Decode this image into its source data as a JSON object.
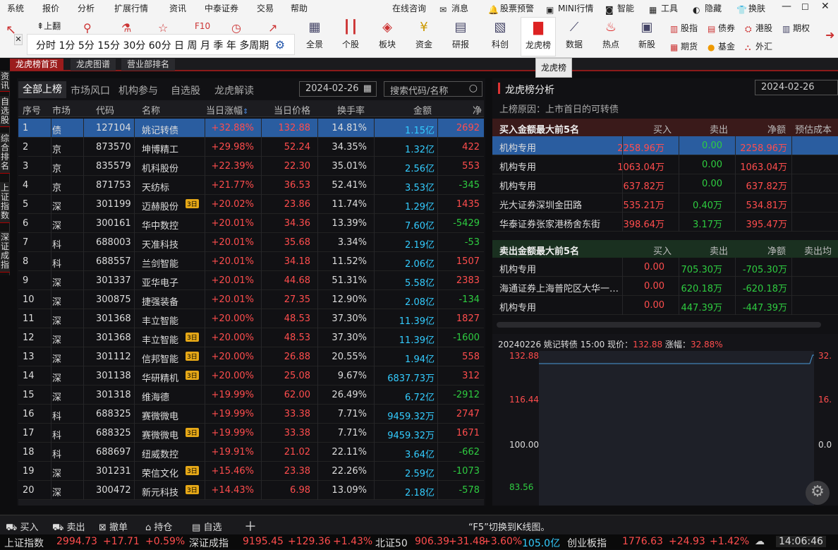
{
  "menu": {
    "items": [
      "系统",
      "报价",
      "分析",
      "扩展行情",
      "资讯",
      "中泰证券",
      "交易",
      "帮助"
    ],
    "right": [
      "在线咨询",
      "消息",
      "股票预警",
      "MINI行情",
      "智能",
      "工具",
      "隐藏",
      "换肤"
    ]
  },
  "toolbar": {
    "left_label": "上翻",
    "buttons": [
      "全景",
      "个股",
      "板块",
      "资金",
      "研报",
      "科创",
      "龙虎榜",
      "数据",
      "热点",
      "新股"
    ],
    "right": [
      [
        "股指",
        "债券",
        "港股",
        "期权"
      ],
      [
        "期货",
        "基金",
        "外汇"
      ]
    ]
  },
  "periods": [
    "分时",
    "1分",
    "5分",
    "15分",
    "30分",
    "60分",
    "日",
    "周",
    "月",
    "季",
    "年",
    "多周期"
  ],
  "tooltip": "龙虎榜",
  "tabs": [
    "龙虎榜首页",
    "龙虎图谱",
    "营业部排名"
  ],
  "sidebar": [
    "资讯",
    "自选股",
    "综合排名",
    "上证指数",
    "深证成指"
  ],
  "left": {
    "subtabs": [
      "全部上榜",
      "市场风口",
      "机构参与",
      "自选股",
      "龙虎解读"
    ],
    "date": "2024-02-26",
    "search_placeholder": "搜索代码/名称",
    "headers": [
      "序号",
      "市场",
      "代码",
      "名称",
      "当日涨幅",
      "当日价格",
      "换手率",
      "金额",
      "净"
    ],
    "rows": [
      [
        "1",
        "债",
        "127104",
        "姚记转债",
        "+32.88%",
        "132.88",
        "14.81%",
        "1.15亿",
        "2692",
        ""
      ],
      [
        "2",
        "京",
        "873570",
        "坤博精工",
        "+29.98%",
        "52.24",
        "34.35%",
        "1.32亿",
        "422",
        ""
      ],
      [
        "3",
        "京",
        "835579",
        "机科股份",
        "+22.39%",
        "22.30",
        "35.01%",
        "2.56亿",
        "553",
        ""
      ],
      [
        "4",
        "京",
        "871753",
        "天纺标",
        "+21.77%",
        "36.53",
        "52.41%",
        "3.53亿",
        "-345",
        ""
      ],
      [
        "5",
        "深",
        "301199",
        "迈赫股份",
        "+20.02%",
        "23.86",
        "11.74%",
        "1.29亿",
        "1435",
        "3日"
      ],
      [
        "6",
        "深",
        "300161",
        "华中数控",
        "+20.01%",
        "34.36",
        "13.39%",
        "7.60亿",
        "-5429",
        ""
      ],
      [
        "7",
        "科",
        "688003",
        "天准科技",
        "+20.01%",
        "35.68",
        "3.34%",
        "2.19亿",
        "-53",
        ""
      ],
      [
        "8",
        "科",
        "688557",
        "兰剑智能",
        "+20.01%",
        "34.18",
        "11.52%",
        "2.06亿",
        "1507",
        ""
      ],
      [
        "9",
        "深",
        "301337",
        "亚华电子",
        "+20.01%",
        "44.68",
        "51.31%",
        "5.58亿",
        "2383",
        ""
      ],
      [
        "10",
        "深",
        "300875",
        "捷强装备",
        "+20.01%",
        "27.35",
        "12.90%",
        "2.08亿",
        "-134",
        ""
      ],
      [
        "11",
        "深",
        "301368",
        "丰立智能",
        "+20.00%",
        "48.53",
        "37.30%",
        "11.39亿",
        "1827",
        ""
      ],
      [
        "12",
        "深",
        "301368",
        "丰立智能",
        "+20.00%",
        "48.53",
        "37.30%",
        "11.39亿",
        "-1600",
        "3日"
      ],
      [
        "13",
        "深",
        "301112",
        "信邦智能",
        "+20.00%",
        "26.88",
        "20.55%",
        "1.94亿",
        "558",
        "3日"
      ],
      [
        "14",
        "深",
        "301138",
        "华研精机",
        "+20.00%",
        "25.08",
        "9.67%",
        "6837.73万",
        "312",
        "3日"
      ],
      [
        "15",
        "深",
        "301318",
        "维海德",
        "+19.99%",
        "62.00",
        "26.49%",
        "6.72亿",
        "-2912",
        ""
      ],
      [
        "16",
        "科",
        "688325",
        "赛微微电",
        "+19.99%",
        "33.38",
        "7.71%",
        "9459.32万",
        "2747",
        ""
      ],
      [
        "17",
        "科",
        "688325",
        "赛微微电",
        "+19.99%",
        "33.38",
        "7.71%",
        "9459.32万",
        "1671",
        "3日"
      ],
      [
        "18",
        "科",
        "688697",
        "纽威数控",
        "+19.91%",
        "21.02",
        "22.11%",
        "3.64亿",
        "-662",
        ""
      ],
      [
        "19",
        "深",
        "301231",
        "荣信文化",
        "+15.46%",
        "23.38",
        "22.26%",
        "2.59亿",
        "-1073",
        "3日"
      ],
      [
        "20",
        "深",
        "300472",
        "新元科技",
        "+14.43%",
        "6.98",
        "13.09%",
        "2.18亿",
        "-578",
        "3日"
      ]
    ]
  },
  "right": {
    "title": "龙虎榜分析",
    "date": "2024-02-26",
    "reason": "上榜原因：上市首日的可转债",
    "buy_head": [
      "买入金额最大前5名",
      "买入",
      "卖出",
      "净额",
      "预估成本"
    ],
    "buy_rows": [
      [
        "机构专用",
        "2258.96万",
        "0.00",
        "2258.96万"
      ],
      [
        "机构专用",
        "1063.04万",
        "0.00",
        "1063.04万"
      ],
      [
        "机构专用",
        "637.82万",
        "0.00",
        "637.82万"
      ],
      [
        "光大证券深圳金田路",
        "535.21万",
        "0.40万",
        "534.81万"
      ],
      [
        "华泰证券张家港杨舍东街",
        "398.64万",
        "3.17万",
        "395.47万"
      ]
    ],
    "sell_head": [
      "卖出金额最大前5名",
      "买入",
      "卖出",
      "净额",
      "卖出均"
    ],
    "sell_rows": [
      [
        "机构专用",
        "0.00",
        "705.30万",
        "-705.30万"
      ],
      [
        "海通证券上海普陀区大华一…",
        "0.00",
        "620.18万",
        "-620.18万"
      ],
      [
        "机构专用",
        "0.00",
        "447.39万",
        "-447.39万"
      ]
    ],
    "chart": {
      "info_prefix": "20240226 姚记转债 15:00 现价：",
      "price": "132.88",
      "chg_label": " 涨幅：",
      "chg": "32.88%",
      "ylabels": [
        "132.88",
        "116.44",
        "100.00",
        "83.56"
      ],
      "rlabels": [
        "32.",
        "16.",
        "0.0"
      ]
    }
  },
  "bottom": {
    "items": [
      "买入",
      "卖出",
      "撤单",
      "持仓",
      "自选"
    ],
    "tip": "“F5”切换到K线图。"
  },
  "ticker": [
    [
      "上证指数",
      "2994.73",
      "+17.71",
      "+0.59%"
    ],
    [
      "深证成指",
      "9195.45",
      "+129.36",
      "+1.43%"
    ],
    [
      "北证50",
      "906.39",
      "+31.48",
      "+3.60%"
    ],
    [
      "",
      "105.0亿",
      "",
      ""
    ],
    [
      "创业板指",
      "1776.63",
      "+24.93",
      "+1.42%"
    ]
  ],
  "clock": "14:06:46"
}
